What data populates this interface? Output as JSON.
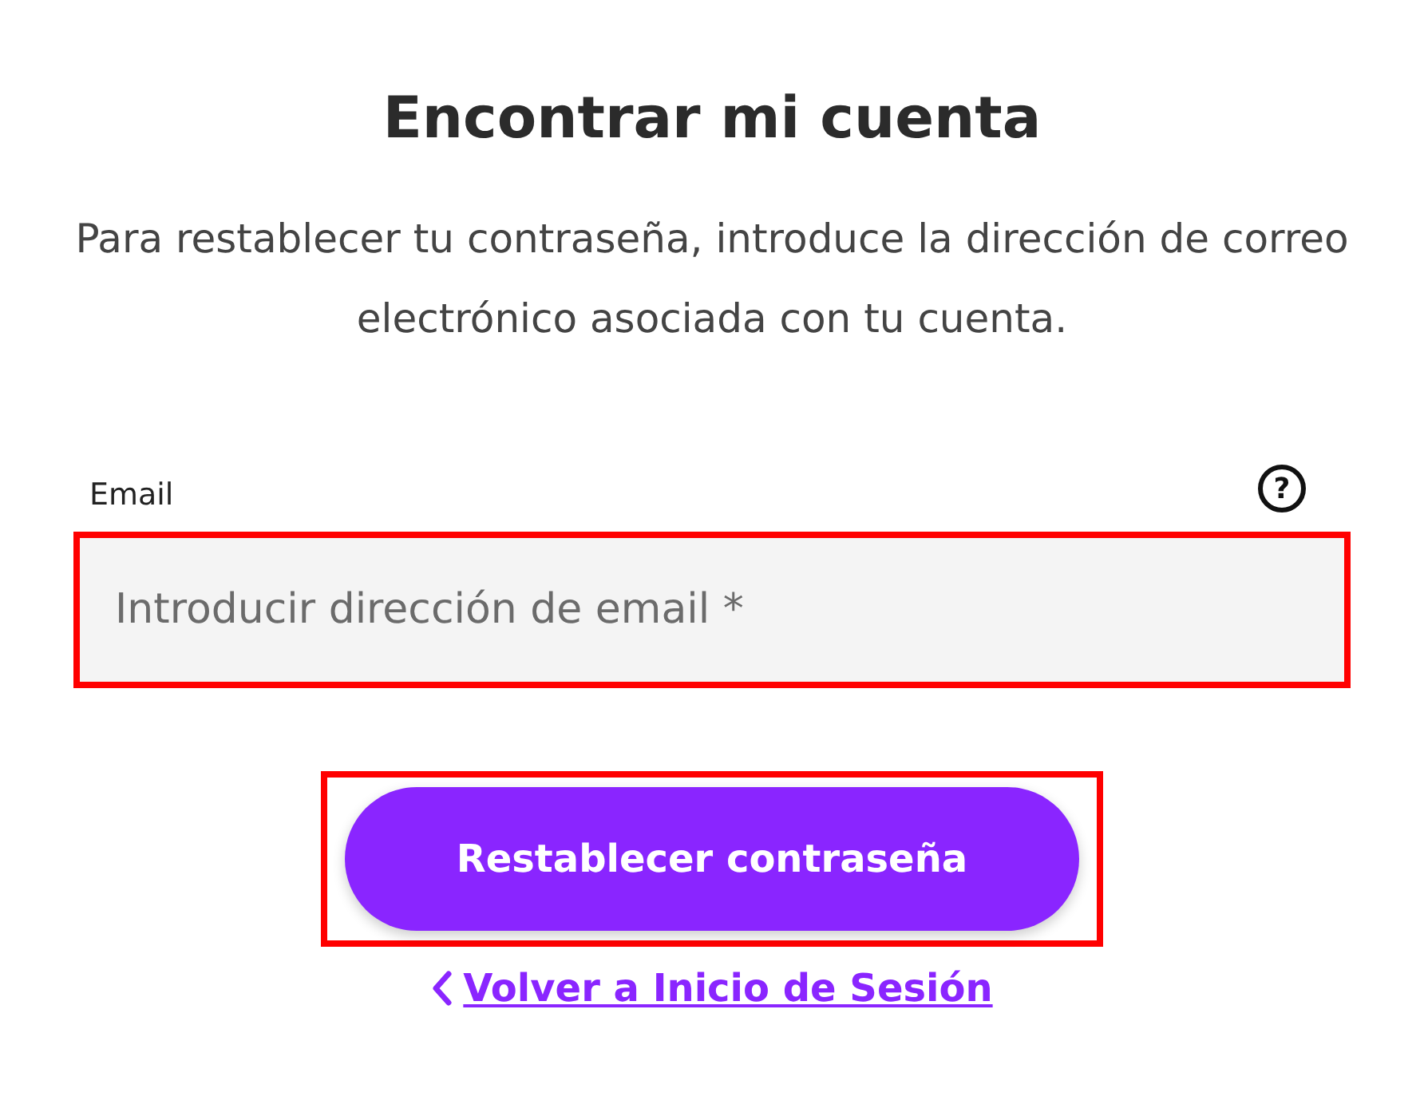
{
  "title": "Encontrar mi cuenta",
  "description": "Para restablecer tu contraseña, introduce la dirección de correo electrónico asociada con tu cuenta.",
  "email_field": {
    "label": "Email",
    "help": "?",
    "placeholder": "Introducir dirección de email *",
    "highlighted": true
  },
  "submit_button": {
    "label": "Restablecer contraseña",
    "highlighted": true
  },
  "back_link": {
    "label": "Volver a Inicio de Sesión"
  }
}
